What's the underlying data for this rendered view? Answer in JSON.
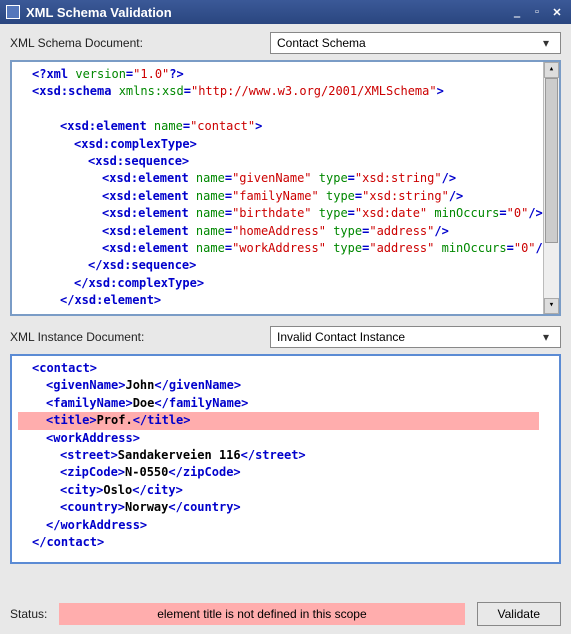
{
  "window": {
    "title": "XML Schema Validation"
  },
  "schema_section": {
    "label": "XML Schema Document:",
    "dropdown": "Contact Schema"
  },
  "schema_code": {
    "l1a": "<?xml",
    "l1b": " version",
    "l1c": "=",
    "l1d": "\"1.0\"",
    "l1e": "?>",
    "l2a": "<xsd:schema",
    "l2b": " xmlns:xsd",
    "l2c": "=",
    "l2d": "\"http://www.w3.org/2001/XMLSchema\"",
    "l2e": ">",
    "l3a": "<xsd:element",
    "l3b": " name",
    "l3c": "=",
    "l3d": "\"contact\"",
    "l3e": ">",
    "l4a": "<xsd:complexType>",
    "l5a": "<xsd:sequence>",
    "l6a": "<xsd:element",
    "l6b": " name",
    "l6c": "=",
    "l6d": "\"givenName\"",
    "l6e": " type",
    "l6f": "=",
    "l6g": "\"xsd:string\"",
    "l6h": "/>",
    "l7a": "<xsd:element",
    "l7b": " name",
    "l7c": "=",
    "l7d": "\"familyName\"",
    "l7e": " type",
    "l7f": "=",
    "l7g": "\"xsd:string\"",
    "l7h": "/>",
    "l8a": "<xsd:element",
    "l8b": " name",
    "l8c": "=",
    "l8d": "\"birthdate\"",
    "l8e": " type",
    "l8f": "=",
    "l8g": "\"xsd:date\"",
    "l8h": " minOccurs",
    "l8i": "=",
    "l8j": "\"0\"",
    "l8k": "/>",
    "l9a": "<xsd:element",
    "l9b": " name",
    "l9c": "=",
    "l9d": "\"homeAddress\"",
    "l9e": " type",
    "l9f": "=",
    "l9g": "\"address\"",
    "l9h": "/>",
    "l10a": "<xsd:element",
    "l10b": " name",
    "l10c": "=",
    "l10d": "\"workAddress\"",
    "l10e": " type",
    "l10f": "=",
    "l10g": "\"address\"",
    "l10h": " minOccurs",
    "l10i": "=",
    "l10j": "\"0\"",
    "l10k": "/>",
    "l11a": "</xsd:sequence>",
    "l12a": "</xsd:complexType>",
    "l13a": "</xsd:element>"
  },
  "instance_section": {
    "label": "XML Instance Document:",
    "dropdown": "Invalid Contact Instance"
  },
  "instance_code": {
    "l1a": "<contact>",
    "l2a": "<givenName>",
    "l2b": "John",
    "l2c": "</givenName>",
    "l3a": "<familyName>",
    "l3b": "Doe",
    "l3c": "</familyName>",
    "l4a": "<title>",
    "l4b": "Prof.",
    "l4c": "</title>",
    "l5a": "<workAddress>",
    "l6a": "<street>",
    "l6b": "Sandakerveien 116",
    "l6c": "</street>",
    "l7a": "<zipCode>",
    "l7b": "N-0550",
    "l7c": "</zipCode>",
    "l8a": "<city>",
    "l8b": "Oslo",
    "l8c": "</city>",
    "l9a": "<country>",
    "l9b": "Norway",
    "l9c": "</country>",
    "l10a": "</workAddress>",
    "l11a": "</contact>"
  },
  "status": {
    "label": "Status:",
    "message": "element title is not defined in this scope",
    "button": "Validate"
  }
}
